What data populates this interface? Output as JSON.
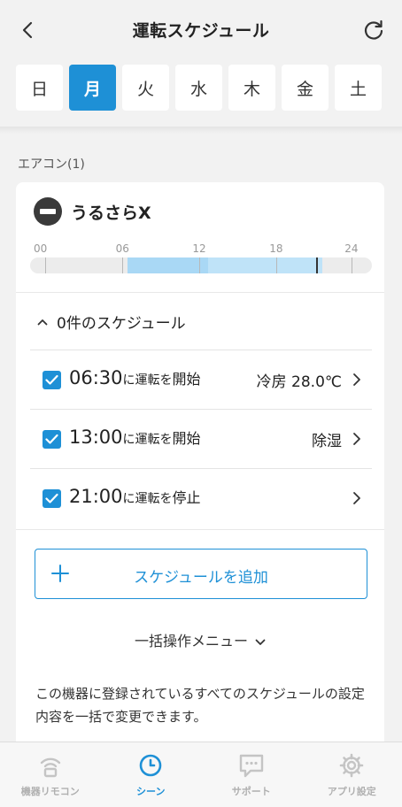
{
  "header": {
    "title": "運転スケジュール"
  },
  "days": [
    "日",
    "月",
    "火",
    "水",
    "木",
    "金",
    "土"
  ],
  "active_day_index": 1,
  "section": {
    "label": "エアコン(1)"
  },
  "device": {
    "name": "うるさらX",
    "timeline_ticks": [
      "00",
      "06",
      "12",
      "18",
      "24"
    ]
  },
  "schedule_count_label": "0件のスケジュール",
  "schedules": [
    {
      "time": "06:30",
      "suffix": "に運転を",
      "action": "開始",
      "mode": "冷房 28.0℃",
      "checked": true
    },
    {
      "time": "13:00",
      "suffix": "に運転を",
      "action": "開始",
      "mode": "除湿",
      "checked": true
    },
    {
      "time": "21:00",
      "suffix": "に運転を",
      "action": "停止",
      "mode": "",
      "checked": true
    }
  ],
  "add_button_label": "スケジュールを追加",
  "bulk_menu_label": "一括操作メニュー",
  "description": "この機器に登録されているすべてのスケジュールの設定内容を一括で変更できます。",
  "tabs": [
    {
      "label": "機器リモコン",
      "icon": "wifi-remote-icon"
    },
    {
      "label": "シーン",
      "icon": "clock-icon"
    },
    {
      "label": "サポート",
      "icon": "chat-bubble-icon"
    },
    {
      "label": "アプリ設定",
      "icon": "gear-icon"
    }
  ],
  "active_tab_index": 1,
  "colors": {
    "accent": "#1e90d6",
    "cool_band": "#a9d8f5",
    "dry_band": "#bfe3f8"
  }
}
